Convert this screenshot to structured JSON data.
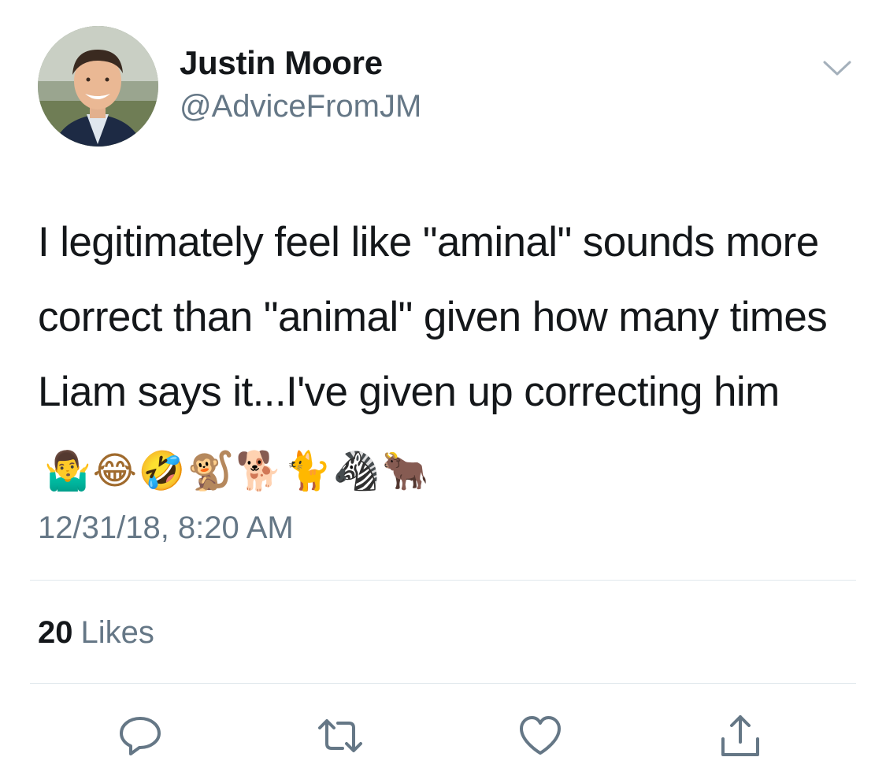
{
  "user": {
    "display_name": "Justin Moore",
    "handle": "@AdviceFromJM",
    "avatar_icon": "profile-photo"
  },
  "tweet": {
    "text": "I legitimately feel like \"aminal\" sounds more correct than \"animal\" given how many times Liam says it...I've given up correcting him",
    "emojis": "🤷‍♂️😂🤣🐒🐕🐈🦓🐂",
    "emoji_names": [
      "man-shrugging",
      "face-with-tears-of-joy",
      "rolling-on-floor-laughing",
      "monkey",
      "dog",
      "cat",
      "zebra",
      "ox"
    ],
    "timestamp": "12/31/18, 8:20 AM"
  },
  "stats": {
    "likes_count": "20",
    "likes_label": "Likes"
  },
  "actions": [
    {
      "name": "reply",
      "icon": "reply-icon"
    },
    {
      "name": "retweet",
      "icon": "retweet-icon"
    },
    {
      "name": "like",
      "icon": "heart-icon"
    },
    {
      "name": "share",
      "icon": "share-icon"
    }
  ],
  "colors": {
    "primary_text": "#14171a",
    "secondary_text": "#657786",
    "divider": "#e1e8ed",
    "icon": "#657786"
  }
}
